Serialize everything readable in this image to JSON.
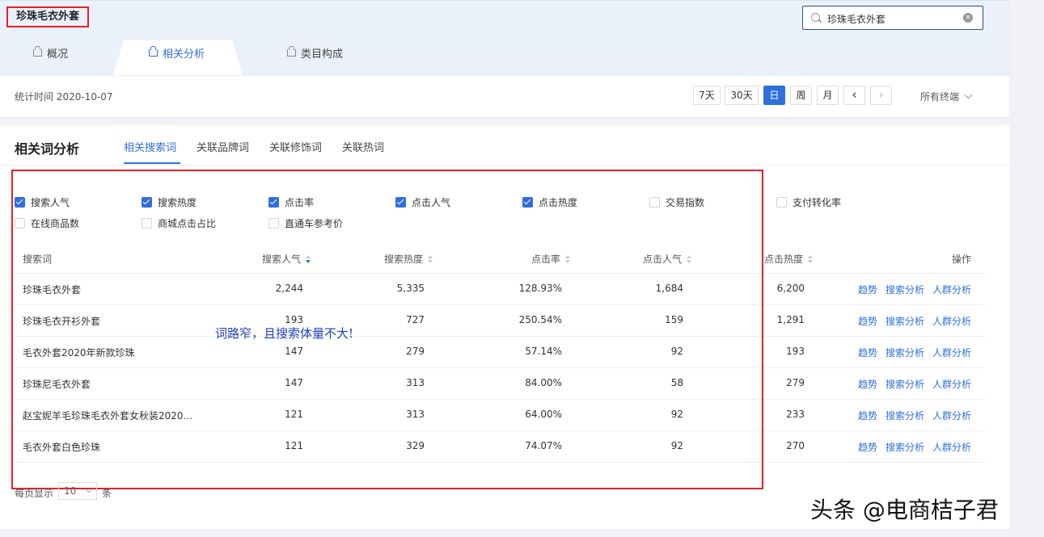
{
  "header": {
    "title": "珍珠毛衣外套",
    "search_value": "珍珠毛衣外套"
  },
  "main_tabs": [
    {
      "label": "概况"
    },
    {
      "label": "相关分析"
    },
    {
      "label": "类目构成"
    }
  ],
  "toolbar": {
    "stat_time": "统计时间 2020-10-07",
    "periods": [
      "7天",
      "30天",
      "日",
      "周",
      "月"
    ],
    "active_period": "日",
    "prev": "‹",
    "next": "›",
    "terminal": "所有终端"
  },
  "section": {
    "title": "相关词分析",
    "tabs": [
      "相关搜索词",
      "关联品牌词",
      "关联修饰词",
      "关联热词"
    ]
  },
  "metrics": [
    {
      "label": "搜索人气",
      "checked": true
    },
    {
      "label": "搜索热度",
      "checked": true
    },
    {
      "label": "点击率",
      "checked": true
    },
    {
      "label": "点击人气",
      "checked": true
    },
    {
      "label": "点击热度",
      "checked": true
    },
    {
      "label": "交易指数",
      "checked": false
    },
    {
      "label": "支付转化率",
      "checked": false
    },
    {
      "label": "在线商品数",
      "checked": false
    },
    {
      "label": "商城点击占比",
      "checked": false
    },
    {
      "label": "直通车参考价",
      "checked": false
    }
  ],
  "table": {
    "headers": [
      "搜索词",
      "搜索人气",
      "搜索热度",
      "点击率",
      "点击人气",
      "点击热度",
      "操作"
    ],
    "rows": [
      [
        "珍珠毛衣外套",
        "2,244",
        "5,335",
        "128.93%",
        "1,684",
        "6,200"
      ],
      [
        "珍珠毛衣开衫外套",
        "193",
        "727",
        "250.54%",
        "159",
        "1,291"
      ],
      [
        "毛衣外套2020年新款珍珠",
        "147",
        "279",
        "57.14%",
        "92",
        "193"
      ],
      [
        "珍珠尼毛衣外套",
        "147",
        "313",
        "84.00%",
        "58",
        "279"
      ],
      [
        "赵宝妮羊毛珍珠毛衣外套女秋装2020...",
        "121",
        "313",
        "64.00%",
        "92",
        "233"
      ],
      [
        "毛衣外套白色珍珠",
        "121",
        "329",
        "74.07%",
        "92",
        "270"
      ]
    ],
    "actions": [
      "趋势",
      "搜索分析",
      "人群分析"
    ]
  },
  "annotation": "词路窄，且搜索体量不大!",
  "pager": {
    "prefix": "每页显示",
    "size": "10",
    "suffix": "条"
  },
  "watermark": "头条 @电商桔子君"
}
